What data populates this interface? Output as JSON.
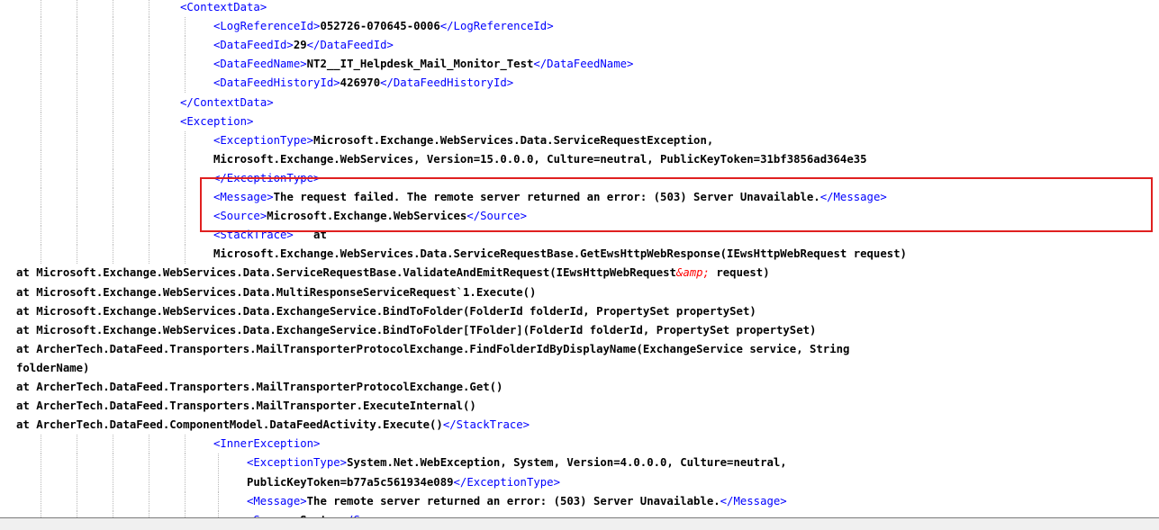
{
  "colors": {
    "tag": "#0000ff",
    "text": "#000000",
    "entity": "#ff0000",
    "highlight": "#e02020",
    "guide": "#b9b9b9"
  },
  "lines": [
    {
      "indent": 200,
      "guides": [
        45,
        85,
        125,
        165
      ],
      "segs": [
        {
          "t": "<ContextData>",
          "c": "tag"
        }
      ]
    },
    {
      "indent": 237,
      "guides": [
        45,
        85,
        125,
        165,
        205
      ],
      "segs": [
        {
          "t": "<LogReferenceId>",
          "c": "tag"
        },
        {
          "t": "052726-070645-0006",
          "c": "txt"
        },
        {
          "t": "</LogReferenceId>",
          "c": "tag"
        }
      ]
    },
    {
      "indent": 237,
      "guides": [
        45,
        85,
        125,
        165,
        205
      ],
      "segs": [
        {
          "t": "<DataFeedId>",
          "c": "tag"
        },
        {
          "t": "29",
          "c": "txt"
        },
        {
          "t": "</DataFeedId>",
          "c": "tag"
        }
      ]
    },
    {
      "indent": 237,
      "guides": [
        45,
        85,
        125,
        165,
        205
      ],
      "segs": [
        {
          "t": "<DataFeedName>",
          "c": "tag"
        },
        {
          "t": "NT2__IT_Helpdesk_Mail_Monitor_Test",
          "c": "txt"
        },
        {
          "t": "</DataFeedName>",
          "c": "tag"
        }
      ]
    },
    {
      "indent": 237,
      "guides": [
        45,
        85,
        125,
        165,
        205
      ],
      "segs": [
        {
          "t": "<DataFeedHistoryId>",
          "c": "tag"
        },
        {
          "t": "426970",
          "c": "txt"
        },
        {
          "t": "</DataFeedHistoryId>",
          "c": "tag"
        }
      ]
    },
    {
      "indent": 200,
      "guides": [
        45,
        85,
        125,
        165
      ],
      "segs": [
        {
          "t": "</ContextData>",
          "c": "tag"
        }
      ]
    },
    {
      "indent": 200,
      "guides": [
        45,
        85,
        125,
        165
      ],
      "segs": [
        {
          "t": "<Exception>",
          "c": "tag"
        }
      ]
    },
    {
      "indent": 237,
      "guides": [
        45,
        85,
        125,
        165,
        205
      ],
      "segs": [
        {
          "t": "<ExceptionType>",
          "c": "tag"
        },
        {
          "t": "Microsoft.Exchange.WebServices.Data.ServiceRequestException,",
          "c": "txt"
        }
      ]
    },
    {
      "indent": 237,
      "guides": [
        45,
        85,
        125,
        165,
        205
      ],
      "segs": [
        {
          "t": "Microsoft.Exchange.WebServices, Version=15.0.0.0, Culture=neutral, PublicKeyToken=31bf3856ad364e35",
          "c": "txt"
        }
      ]
    },
    {
      "indent": 237,
      "guides": [
        45,
        85,
        125,
        165,
        205
      ],
      "segs": [
        {
          "t": "</ExceptionType>",
          "c": "tag"
        }
      ]
    },
    {
      "indent": 237,
      "guides": [
        45,
        85,
        125,
        165,
        205
      ],
      "segs": [
        {
          "t": "<Message>",
          "c": "tag"
        },
        {
          "t": "The request failed. The remote server returned an error: (503) Server Unavailable.",
          "c": "txt"
        },
        {
          "t": "</Message>",
          "c": "tag"
        }
      ]
    },
    {
      "indent": 237,
      "guides": [
        45,
        85,
        125,
        165,
        205
      ],
      "segs": [
        {
          "t": "<Source>",
          "c": "tag"
        },
        {
          "t": "Microsoft.Exchange.WebServices",
          "c": "txt"
        },
        {
          "t": "</Source>",
          "c": "tag"
        }
      ]
    },
    {
      "indent": 237,
      "guides": [
        45,
        85,
        125,
        165,
        205
      ],
      "segs": [
        {
          "t": "<StackTrace>",
          "c": "tag"
        },
        {
          "t": "   at",
          "c": "txt"
        }
      ]
    },
    {
      "indent": 237,
      "guides": [
        45,
        85,
        125,
        165,
        205
      ],
      "segs": [
        {
          "t": "Microsoft.Exchange.WebServices.Data.ServiceRequestBase.GetEwsHttpWebResponse(IEwsHttpWebRequest request)",
          "c": "txt"
        }
      ]
    },
    {
      "indent": 18,
      "guides": [],
      "segs": [
        {
          "t": "at Microsoft.Exchange.WebServices.Data.ServiceRequestBase.ValidateAndEmitRequest(IEwsHttpWebRequest",
          "c": "txt"
        },
        {
          "t": "&amp;",
          "c": "ent"
        },
        {
          "t": " request)",
          "c": "txt"
        }
      ]
    },
    {
      "indent": 18,
      "guides": [],
      "segs": [
        {
          "t": "at Microsoft.Exchange.WebServices.Data.MultiResponseServiceRequest`1.Execute()",
          "c": "txt"
        }
      ]
    },
    {
      "indent": 18,
      "guides": [],
      "segs": [
        {
          "t": "at Microsoft.Exchange.WebServices.Data.ExchangeService.BindToFolder(FolderId folderId, PropertySet propertySet)",
          "c": "txt"
        }
      ]
    },
    {
      "indent": 18,
      "guides": [],
      "segs": [
        {
          "t": "at Microsoft.Exchange.WebServices.Data.ExchangeService.BindToFolder[TFolder](FolderId folderId, PropertySet propertySet)",
          "c": "txt"
        }
      ]
    },
    {
      "indent": 18,
      "guides": [],
      "segs": [
        {
          "t": "at ArcherTech.DataFeed.Transporters.MailTransporterProtocolExchange.FindFolderIdByDisplayName(ExchangeService service, String",
          "c": "txt"
        }
      ]
    },
    {
      "indent": 18,
      "guides": [],
      "segs": [
        {
          "t": "folderName)",
          "c": "txt"
        }
      ]
    },
    {
      "indent": 18,
      "guides": [],
      "segs": [
        {
          "t": "at ArcherTech.DataFeed.Transporters.MailTransporterProtocolExchange.Get()",
          "c": "txt"
        }
      ]
    },
    {
      "indent": 18,
      "guides": [],
      "segs": [
        {
          "t": "at ArcherTech.DataFeed.Transporters.MailTransporter.ExecuteInternal()",
          "c": "txt"
        }
      ]
    },
    {
      "indent": 18,
      "guides": [],
      "segs": [
        {
          "t": "at ArcherTech.DataFeed.ComponentModel.DataFeedActivity.Execute()",
          "c": "txt"
        },
        {
          "t": "</StackTrace>",
          "c": "tag"
        }
      ]
    },
    {
      "indent": 237,
      "guides": [
        45,
        85,
        125,
        165,
        205
      ],
      "segs": [
        {
          "t": "<InnerException>",
          "c": "tag"
        }
      ]
    },
    {
      "indent": 274,
      "guides": [
        45,
        85,
        125,
        165,
        205,
        242
      ],
      "segs": [
        {
          "t": "<ExceptionType>",
          "c": "tag"
        },
        {
          "t": "System.Net.WebException, System, Version=4.0.0.0, Culture=neutral,",
          "c": "txt"
        }
      ]
    },
    {
      "indent": 274,
      "guides": [
        45,
        85,
        125,
        165,
        205,
        242
      ],
      "segs": [
        {
          "t": "PublicKeyToken=b77a5c561934e089",
          "c": "txt"
        },
        {
          "t": "</ExceptionType>",
          "c": "tag"
        }
      ]
    },
    {
      "indent": 274,
      "guides": [
        45,
        85,
        125,
        165,
        205,
        242
      ],
      "segs": [
        {
          "t": "<Message>",
          "c": "tag"
        },
        {
          "t": "The remote server returned an error: (503) Server Unavailable.",
          "c": "txt"
        },
        {
          "t": "</Message>",
          "c": "tag"
        }
      ]
    },
    {
      "indent": 274,
      "guides": [
        45,
        85,
        125,
        165,
        205,
        242
      ],
      "segs": [
        {
          "t": "<Source>",
          "c": "tag"
        },
        {
          "t": "System",
          "c": "txt"
        },
        {
          "t": "</Source>",
          "c": "tag"
        }
      ]
    }
  ]
}
